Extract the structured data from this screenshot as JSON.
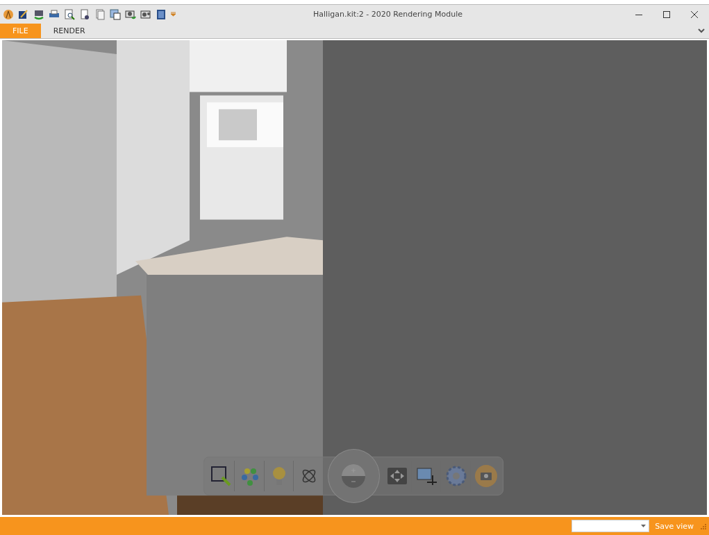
{
  "window": {
    "title": "Halligan.kit:2 - 2020 Rendering Module"
  },
  "tabs": [
    {
      "label": "FILE",
      "selected": true
    },
    {
      "label": "RENDER",
      "selected": false
    }
  ],
  "status_bar": {
    "save_button": "Save view"
  }
}
